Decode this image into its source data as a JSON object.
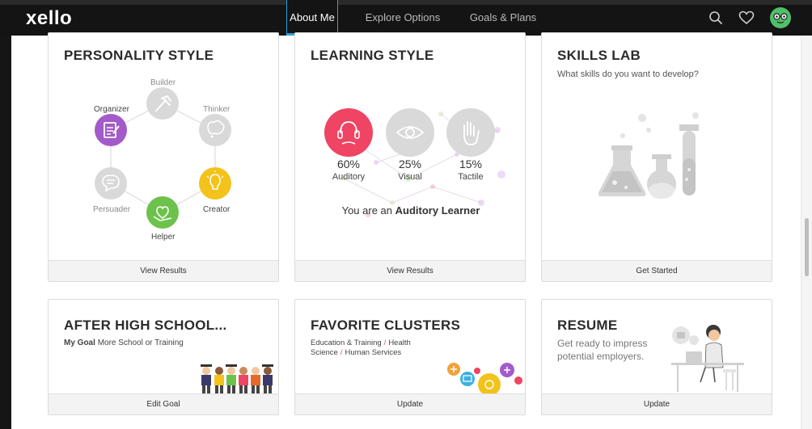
{
  "header": {
    "logo": "xello",
    "nav": [
      {
        "label": "About Me",
        "active": true
      },
      {
        "label": "Explore Options",
        "active": false
      },
      {
        "label": "Goals & Plans",
        "active": false
      }
    ],
    "icons": [
      "search-icon",
      "heart-icon",
      "avatar"
    ]
  },
  "cards": {
    "personality": {
      "title": "PERSONALITY STYLE",
      "labels": {
        "builder": "Builder",
        "thinker": "Thinker",
        "organizer": "Organizer",
        "persuader": "Persuader",
        "creator": "Creator",
        "helper": "Helper"
      },
      "footer": "View Results"
    },
    "learning": {
      "title": "LEARNING STYLE",
      "styles": [
        {
          "pct": "60%",
          "name": "Auditory"
        },
        {
          "pct": "25%",
          "name": "Visual"
        },
        {
          "pct": "15%",
          "name": "Tactile"
        }
      ],
      "result_prefix": "You are an",
      "result_bold": "Auditory Learner",
      "footer": "View Results"
    },
    "skills": {
      "title": "SKILLS LAB",
      "subtitle": "What skills do you want to develop?",
      "footer": "Get Started"
    },
    "after": {
      "title": "AFTER HIGH SCHOOL...",
      "goal_label": "My Goal",
      "goal_value": "More School or Training",
      "footer": "Edit Goal"
    },
    "clusters": {
      "title": "FAVORITE CLUSTERS",
      "items": [
        "Education & Training",
        "Health Science",
        "Human Services"
      ],
      "footer": "Update"
    },
    "resume": {
      "title": "RESUME",
      "subtitle": "Get ready to impress potential employers.",
      "footer": "Update"
    }
  },
  "colors": {
    "accent": "#2c9fd8",
    "auditory": "#ef4463",
    "organizer": "#a35bc9",
    "creator": "#f3c21b",
    "helper": "#6cc24a",
    "neutral": "#d6d6d6"
  }
}
